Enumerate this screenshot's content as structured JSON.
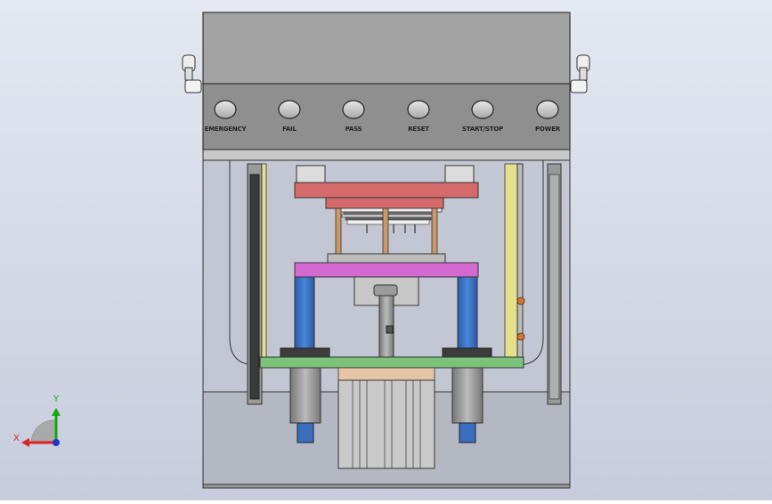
{
  "viewport": {
    "background_top": "#e4e8f2",
    "background_bottom": "#c7ccdd"
  },
  "panel": {
    "buttons": [
      {
        "label": "EMERGENCY"
      },
      {
        "label": "FAIL"
      },
      {
        "label": "PASS"
      },
      {
        "label": "RESET"
      },
      {
        "label": "START/STOP"
      },
      {
        "label": "POWER"
      }
    ]
  },
  "colors": {
    "upper_plate": "#d46a6a",
    "middle_plate": "#d46ad1",
    "guide_columns": "#3a6fc0",
    "base_plate": "#7cc27a",
    "guide_rods": "#c89a6b",
    "side_rail": "#e6e08c"
  },
  "triad": {
    "x_label": "X",
    "y_label": "Y",
    "x_color": "#d22",
    "y_color": "#1a1"
  }
}
